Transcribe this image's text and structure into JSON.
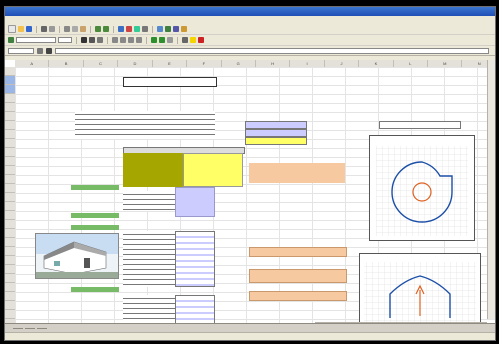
{
  "window": {
    "title": ""
  },
  "menu": {
    "items": [
      "",
      "",
      "",
      "",
      "",
      "",
      "",
      "",
      ""
    ]
  },
  "formula": {
    "cell_ref": "",
    "content": ""
  },
  "sheet": {
    "columns": [
      "A",
      "B",
      "C",
      "D",
      "E",
      "F",
      "G",
      "H",
      "I",
      "J",
      "K",
      "L",
      "M",
      "N"
    ],
    "sheet_title": "",
    "paragraph_text": "",
    "notes_right": "",
    "chart_top_title": "",
    "chart_bottom_title": ""
  },
  "tabs": [
    "",
    "",
    ""
  ],
  "status": {
    "text": ""
  },
  "colors": {
    "olive": "#a6a600",
    "yellow": "#ffff66",
    "peach": "#f7c9a0",
    "lavender": "#ccccff",
    "green": "#77bb66",
    "orange_circle": "#e06020",
    "blue_stroke": "#1c4fa8"
  },
  "icons": [
    "new-icon",
    "open-icon",
    "save-icon",
    "print-icon",
    "cut-icon",
    "copy-icon",
    "paste-icon",
    "undo-icon",
    "redo-icon",
    "chart-icon",
    "sort-icon",
    "bold-icon",
    "italic-icon",
    "underline-icon",
    "align-left-icon",
    "align-center-icon",
    "align-right-icon",
    "percent-icon",
    "border-icon",
    "fill-color-icon",
    "font-color-icon"
  ]
}
